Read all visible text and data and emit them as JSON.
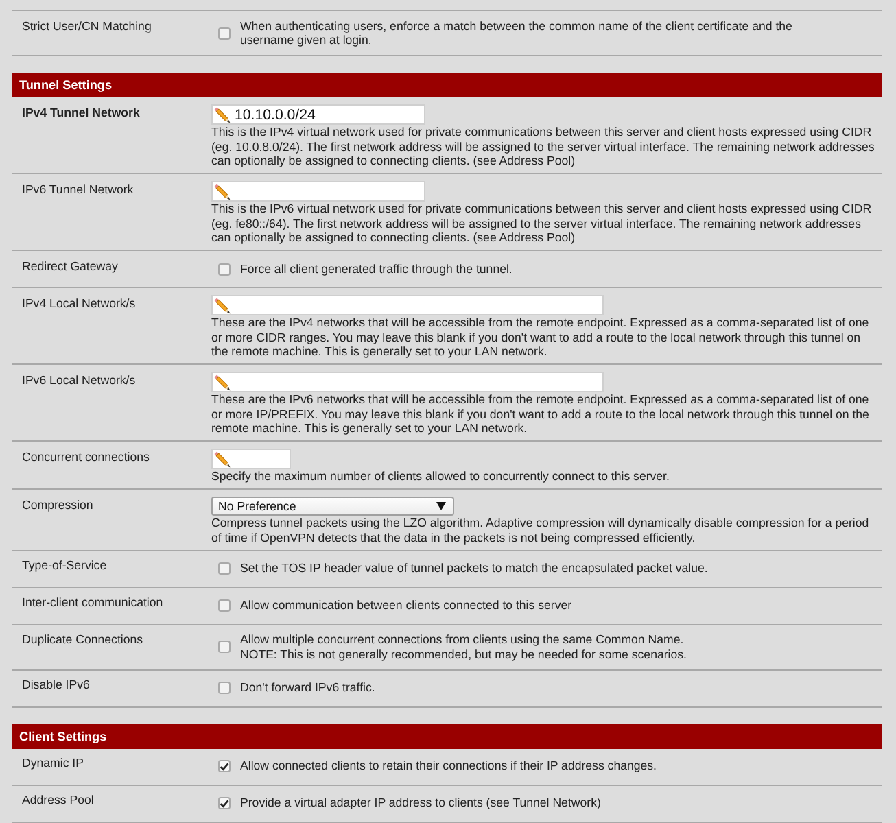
{
  "rows_above": [
    {
      "kind": "checkbox",
      "label": "Strict User/CN Matching",
      "required": false,
      "checked": false,
      "text": "When authenticating users, enforce a match between the common name of the client certificate and the username given at login."
    }
  ],
  "sections": [
    {
      "title": "Tunnel Settings",
      "rows": [
        {
          "kind": "input",
          "label": "IPv4 Tunnel Network",
          "required": true,
          "value": "10.10.0.0/24",
          "description": "This is the IPv4 virtual network used for private communications between this server and client hosts expressed using CIDR (eg. 10.0.8.0/24). The first network address will be assigned to the server virtual interface. The remaining network addresses can optionally be assigned to connecting clients. (see Address Pool)"
        },
        {
          "kind": "input",
          "label": "IPv6 Tunnel Network",
          "required": false,
          "description": "This is the IPv6 virtual network used for private communications between this server and client hosts expressed using CIDR (eg. fe80::/64). The first network address will be assigned to the server virtual interface. The remaining network addresses can optionally be assigned to connecting clients. (see Address Pool)"
        },
        {
          "kind": "checkbox",
          "label": "Redirect Gateway",
          "required": false,
          "checked": false,
          "text": "Force all client generated traffic through the tunnel."
        },
        {
          "kind": "input",
          "label": "IPv4 Local Network/s",
          "required": false,
          "description": "These are the IPv4 networks that will be accessible from the remote endpoint. Expressed as a comma-separated list of one or more CIDR ranges. You may leave this blank if you don't want to add a route to the local network through this tunnel on the remote machine. This is generally set to your LAN network."
        },
        {
          "kind": "input",
          "label": "IPv6 Local Network/s",
          "required": false,
          "description": "These are the IPv6 networks that will be accessible from the remote endpoint. Expressed as a comma-separated list of one or more IP/PREFIX. You may leave this blank if you don't want to add a route to the local network through this tunnel on the remote machine. This is generally set to your LAN network."
        },
        {
          "kind": "input",
          "label": "Concurrent connections",
          "required": false,
          "description": "Specify the maximum number of clients allowed to concurrently connect to this server."
        },
        {
          "kind": "select",
          "label": "Compression",
          "required": false,
          "value": "No Preference",
          "description": "Compress tunnel packets using the LZO algorithm. Adaptive compression will dynamically disable compression for a period of time if OpenVPN detects that the data in the packets is not being compressed efficiently."
        },
        {
          "kind": "checkbox",
          "label": "Type-of-Service",
          "required": false,
          "checked": false,
          "text": "Set the TOS IP header value of tunnel packets to match the encapsulated packet value."
        },
        {
          "kind": "checkbox",
          "label": "Inter-client communication",
          "required": false,
          "checked": false,
          "text": "Allow communication between clients connected to this server"
        },
        {
          "kind": "checkbox",
          "label": "Duplicate Connections",
          "required": false,
          "checked": false,
          "text": "Allow multiple concurrent connections from clients using the same Common Name.",
          "note": "NOTE: This is not generally recommended, but may be needed for some scenarios."
        },
        {
          "kind": "checkbox",
          "label": "Disable IPv6",
          "required": false,
          "checked": false,
          "text": "Don't forward IPv6 traffic."
        }
      ]
    },
    {
      "title": "Client Settings",
      "rows": [
        {
          "kind": "checkbox",
          "label": "Dynamic IP",
          "required": false,
          "checked": true,
          "text": "Allow connected clients to retain their connections if their IP address changes."
        },
        {
          "kind": "checkbox",
          "label": "Address Pool",
          "required": false,
          "checked": true,
          "text": "Provide a virtual adapter IP address to clients (see Tunnel Network)"
        }
      ]
    }
  ]
}
